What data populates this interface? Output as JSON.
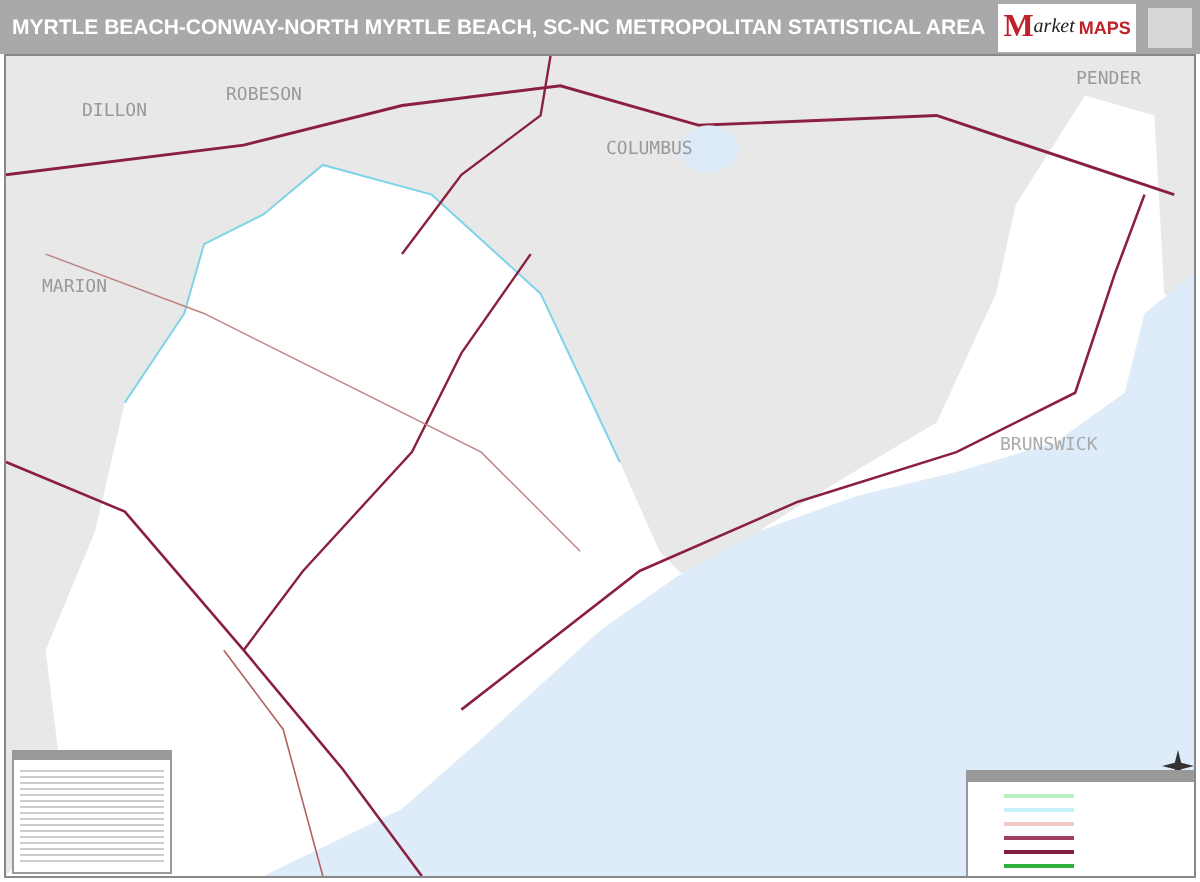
{
  "title": "MYRTLE BEACH-CONWAY-NORTH MYRTLE BEACH, SC-NC METROPOLITAN STATISTICAL AREA",
  "logo": {
    "initial": "M",
    "word": "arket",
    "brand": "MAPS"
  },
  "counties": [
    {
      "name": "DILLON",
      "kind": "outside"
    },
    {
      "name": "ROBESON",
      "kind": "outside"
    },
    {
      "name": "COLUMBUS",
      "kind": "outside"
    },
    {
      "name": "MARION",
      "kind": "outside"
    },
    {
      "name": "PENDER",
      "kind": "outside"
    },
    {
      "name": "BRUNSWICK",
      "kind": "inside"
    }
  ]
}
